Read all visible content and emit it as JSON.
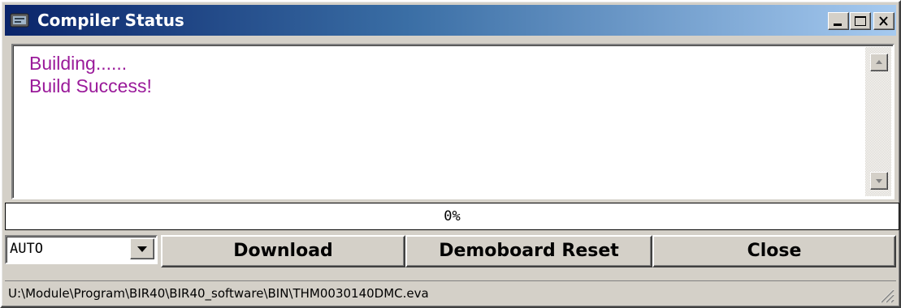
{
  "window": {
    "title": "Compiler Status",
    "minimize_icon": "minimize-icon",
    "maximize_icon": "maximize-icon",
    "close_icon": "close-icon"
  },
  "output": {
    "lines": [
      "Building......",
      "Build Success!"
    ],
    "text_color": "#9a1a9a"
  },
  "progress": {
    "label": "0%",
    "value": 0
  },
  "mode_select": {
    "selected": "AUTO"
  },
  "buttons": {
    "download": "Download",
    "demoboard_reset": "Demoboard Reset",
    "close": "Close"
  },
  "status": {
    "path": "U:\\Module\\Program\\BIR40\\BIR40_software\\BIN\\THM0030140DMC.eva"
  },
  "colors": {
    "titlebar_start": "#0a246a",
    "titlebar_end": "#a6caf0",
    "face": "#d4d0c8"
  }
}
